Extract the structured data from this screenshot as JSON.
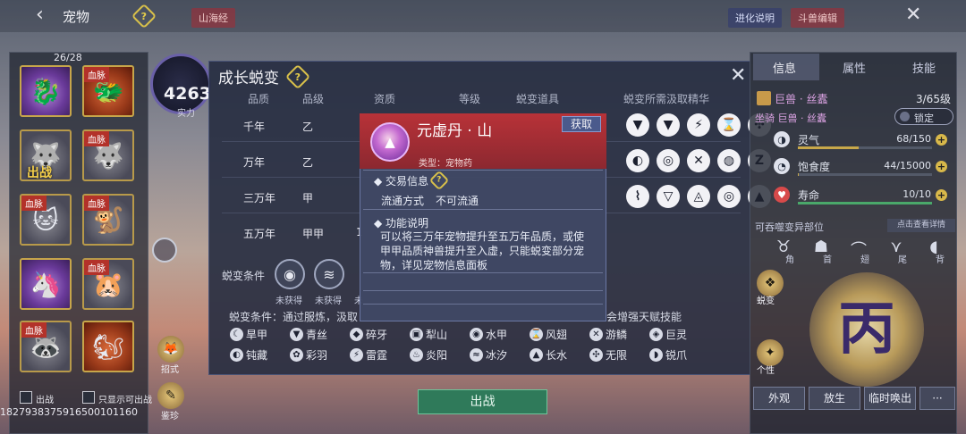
{
  "topbar": {
    "back_glyph": "‹",
    "title": "宠物",
    "help_glyph": "?",
    "tag_shanhaijing": "山海经",
    "btn_evolve_desc": "进化说明",
    "btn_dou_edit": "斗兽编辑",
    "close_glyph": "✕"
  },
  "pets": {
    "count": "26/28",
    "slots": [
      {
        "tag": "",
        "style": "p",
        "glyph": "🐉"
      },
      {
        "tag": "血脉",
        "style": "r",
        "glyph": "🐲"
      },
      {
        "tag": "",
        "style": "gy",
        "glyph": "🐺",
        "overlay": "出战"
      },
      {
        "tag": "血脉",
        "style": "gy",
        "glyph": "🐺"
      },
      {
        "tag": "血脉",
        "style": "gy",
        "glyph": "🐱"
      },
      {
        "tag": "血脉",
        "style": "gy",
        "glyph": "🐒"
      },
      {
        "tag": "",
        "style": "p",
        "glyph": "🦄"
      },
      {
        "tag": "血脉",
        "style": "gy",
        "glyph": "🐹"
      },
      {
        "tag": "血脉",
        "style": "gy",
        "glyph": "🦝"
      },
      {
        "tag": "",
        "style": "r",
        "glyph": "🐿"
      }
    ],
    "bottom_check_1": "出战",
    "bottom_check_2": "只显示可出战"
  },
  "power": {
    "value": "4263",
    "label": "实力"
  },
  "dialog": {
    "title": "成长蜕变",
    "help_glyph": "?",
    "close_glyph": "✕",
    "headers": [
      "品质",
      "品级",
      "资质",
      "等级",
      "蜕变道具",
      "蜕变所需汲取精华"
    ],
    "rows": [
      {
        "quality": "千年",
        "grade": "乙",
        "essence": [
          "▼",
          "▼",
          "⚡",
          "⌛",
          "✣"
        ]
      },
      {
        "quality": "万年",
        "grade": "乙",
        "essence": [
          "◐",
          "◎",
          "✕",
          "◍",
          "Z"
        ]
      },
      {
        "quality": "三万年",
        "grade": "甲",
        "essence": [
          "⌇",
          "▽",
          "◬",
          "◎",
          "▲"
        ]
      },
      {
        "quality": "五万年",
        "grade": "甲甲",
        "extra": "1",
        "essence": []
      }
    ],
    "condition_label": "蜕变条件",
    "condition_items": [
      {
        "glyph": "◉",
        "status": "未获得"
      },
      {
        "glyph": "≋",
        "status": "未获得"
      },
      {
        "glyph": "",
        "status": "未"
      }
    ],
    "bottom_text_left": "蜕变条件：通过服炼，汲取",
    "bottom_text_right": "会增强天赋技能",
    "essences": [
      {
        "glyph": "☾",
        "name": "旱甲"
      },
      {
        "glyph": "▼",
        "name": "青丝"
      },
      {
        "glyph": "◆",
        "name": "碎牙"
      },
      {
        "glyph": "▣",
        "name": "犁山"
      },
      {
        "glyph": "◉",
        "name": "水甲"
      },
      {
        "glyph": "⌛",
        "name": "风翅"
      },
      {
        "glyph": "✕",
        "name": "游鳞"
      },
      {
        "glyph": "◈",
        "name": "巨灵"
      },
      {
        "glyph": "◐",
        "name": "钝藏"
      },
      {
        "glyph": "✿",
        "name": "彩羽"
      },
      {
        "glyph": "⚡",
        "name": "雷霆"
      },
      {
        "glyph": "♨",
        "name": "炎阳"
      },
      {
        "glyph": "≈",
        "name": "冰汐"
      },
      {
        "glyph": "▲",
        "name": "长水"
      },
      {
        "glyph": "✣",
        "name": "无限"
      },
      {
        "glyph": "◗",
        "name": "锐爪"
      }
    ]
  },
  "popup": {
    "item_glyph": "▲",
    "name": "元虚丹 · 山",
    "get_btn": "获取",
    "type": "类型：宠物药",
    "trade_title": "交易信息",
    "trade_help": "?",
    "trade_label": "流通方式",
    "trade_value": "不可流通",
    "func_title": "功能说明",
    "func_body": "可以将三万年宠物提升至五万年品质，或使甲甲品质神兽提升至入虚，只能蜕变部分宠物，详见宠物信息面板"
  },
  "right": {
    "tabs": [
      "信息",
      "属性",
      "技能"
    ],
    "active_tab": 0,
    "species_1": "巨兽 · 丝蠹",
    "level": "3/65级",
    "species_2": "坐骑 巨兽 · 丝蠹",
    "lock_btn": "锁定",
    "stats": [
      {
        "glyph": "◑",
        "label": "灵气",
        "value": "68/150",
        "ratio": 0.45
      },
      {
        "glyph": "◔",
        "label": "饱食度",
        "value": "44/15000",
        "ratio": 0.003
      },
      {
        "glyph": "♥",
        "label": "寿命",
        "value": "10/10",
        "ratio": 1.0
      }
    ],
    "mutation_label": "可吞噬变异部位",
    "mutation_detail_btn": "点击查看详情",
    "mutation_parts": [
      {
        "glyph": "♉",
        "label": "角"
      },
      {
        "glyph": "☗",
        "label": "首"
      },
      {
        "glyph": "⌒",
        "label": "翅"
      },
      {
        "glyph": "⋎",
        "label": "尾"
      },
      {
        "glyph": "◖",
        "label": "背"
      }
    ],
    "side_evolve": "蜕变",
    "side_trait": "个性",
    "rune_glyph": "丙",
    "buttons": [
      "外观",
      "放生",
      "临时唤出",
      "···"
    ]
  },
  "side_left": [
    {
      "glyph": "🦊",
      "label": "招式"
    },
    {
      "glyph": "✎",
      "label": "鉴珍"
    }
  ],
  "out_button": "出战",
  "id_text": "1827938375916500101160"
}
